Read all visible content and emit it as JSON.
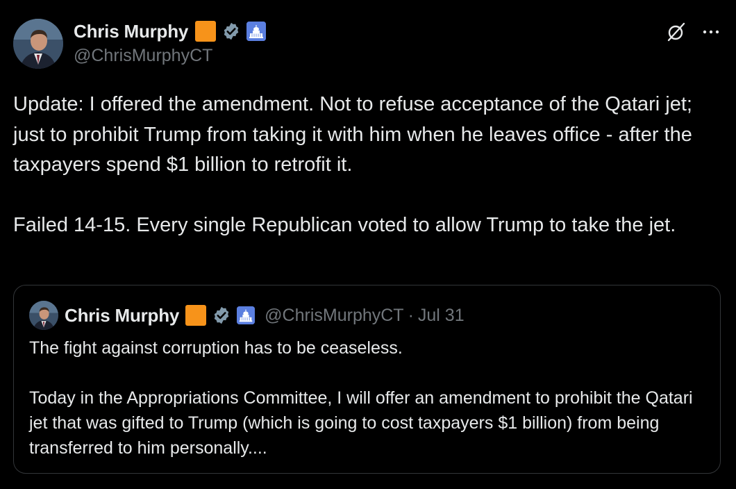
{
  "author": {
    "name": "Chris Murphy",
    "handle": "@ChrisMurphyCT"
  },
  "icons": {
    "avatar": "avatar",
    "badge_color": "#f7931a",
    "verified": "verified-badge-icon",
    "capitol": "capitol-affiliation-icon",
    "grok": "grok-icon",
    "more": "more-options-icon"
  },
  "tweet": {
    "text": "Update: I offered the amendment. Not to refuse acceptance of the Qatari jet; just to prohibit Trump from taking it with him when he leaves office - after the taxpayers spend $1 billion to retrofit it.\n\nFailed 14-15. Every single Republican voted to allow Trump to take the jet."
  },
  "quote": {
    "name": "Chris Murphy",
    "handle": "@ChrisMurphyCT",
    "separator": "·",
    "date": "Jul 31",
    "text": "The fight against corruption has to be ceaseless.\n\nToday in the Appropriations Committee, I will offer an amendment to prohibit the Qatari jet that was gifted to Trump (which is going to cost taxpayers $1 billion) from being transferred to him personally...."
  },
  "colors": {
    "background": "#000000",
    "text": "#e7e9ea",
    "muted": "#71767b",
    "border": "#333639",
    "verified_blue": "#829aab"
  }
}
